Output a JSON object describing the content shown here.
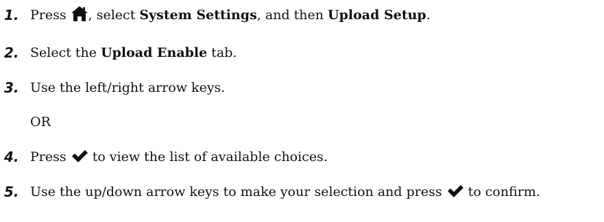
{
  "steps": [
    {
      "number": "1.",
      "t1": "Press ",
      "t2": ", select ",
      "b1": "System Settings",
      "t3": ", and then ",
      "b2": "Upload Setup",
      "t4": "."
    },
    {
      "number": "2.",
      "t1": "Select the ",
      "b1": "Upload Enable",
      "t2": " tab."
    },
    {
      "number": "3.",
      "t1": "Use the left/right arrow keys."
    },
    {
      "or_label": "OR"
    },
    {
      "number": "4.",
      "t1": "Press ",
      "t2": " to view the list of available choices."
    },
    {
      "number": "5.",
      "t1": "Use the up/down arrow keys to make your selection and press ",
      "t2": " to confirm."
    }
  ],
  "icons": {
    "home": "home-icon",
    "check": "checkmark-icon"
  }
}
